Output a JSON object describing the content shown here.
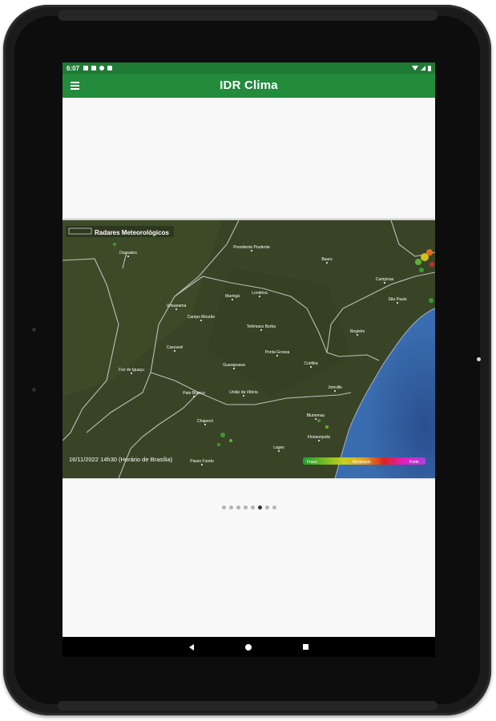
{
  "status_bar": {
    "time": "6:07"
  },
  "app_bar": {
    "title": "IDR Clima"
  },
  "radar": {
    "header": "Radares Meteorológicos",
    "timestamp": "16/11/2022 14h30 (Horário de Brasília)",
    "legend": {
      "low": "Fraco",
      "mid": "Moderado",
      "high": "Forte"
    },
    "colors": {
      "land": "#3a4526",
      "ocean": "#2f5c9c",
      "borders": "#d8d8d8"
    },
    "cities": [
      {
        "name": "Dourados"
      },
      {
        "name": "Presidente Prudente"
      },
      {
        "name": "Bauru"
      },
      {
        "name": "Campinas"
      },
      {
        "name": "São Paulo"
      },
      {
        "name": "Maringá"
      },
      {
        "name": "Londrina"
      },
      {
        "name": "Umuarama"
      },
      {
        "name": "Campo Mourão"
      },
      {
        "name": "Telêmaco Borba"
      },
      {
        "name": "Registro"
      },
      {
        "name": "Cascavel"
      },
      {
        "name": "Ponta Grossa"
      },
      {
        "name": "Foz do Iguaçu"
      },
      {
        "name": "Guarapuava"
      },
      {
        "name": "Curitiba"
      },
      {
        "name": "Pato Branco"
      },
      {
        "name": "União da Vitória"
      },
      {
        "name": "Joinville"
      },
      {
        "name": "Chapecó"
      },
      {
        "name": "Blumenau"
      },
      {
        "name": "Florianópolis"
      },
      {
        "name": "Lages"
      },
      {
        "name": "Passo Fundo"
      }
    ]
  },
  "pager": {
    "count": 8,
    "active": 5
  }
}
